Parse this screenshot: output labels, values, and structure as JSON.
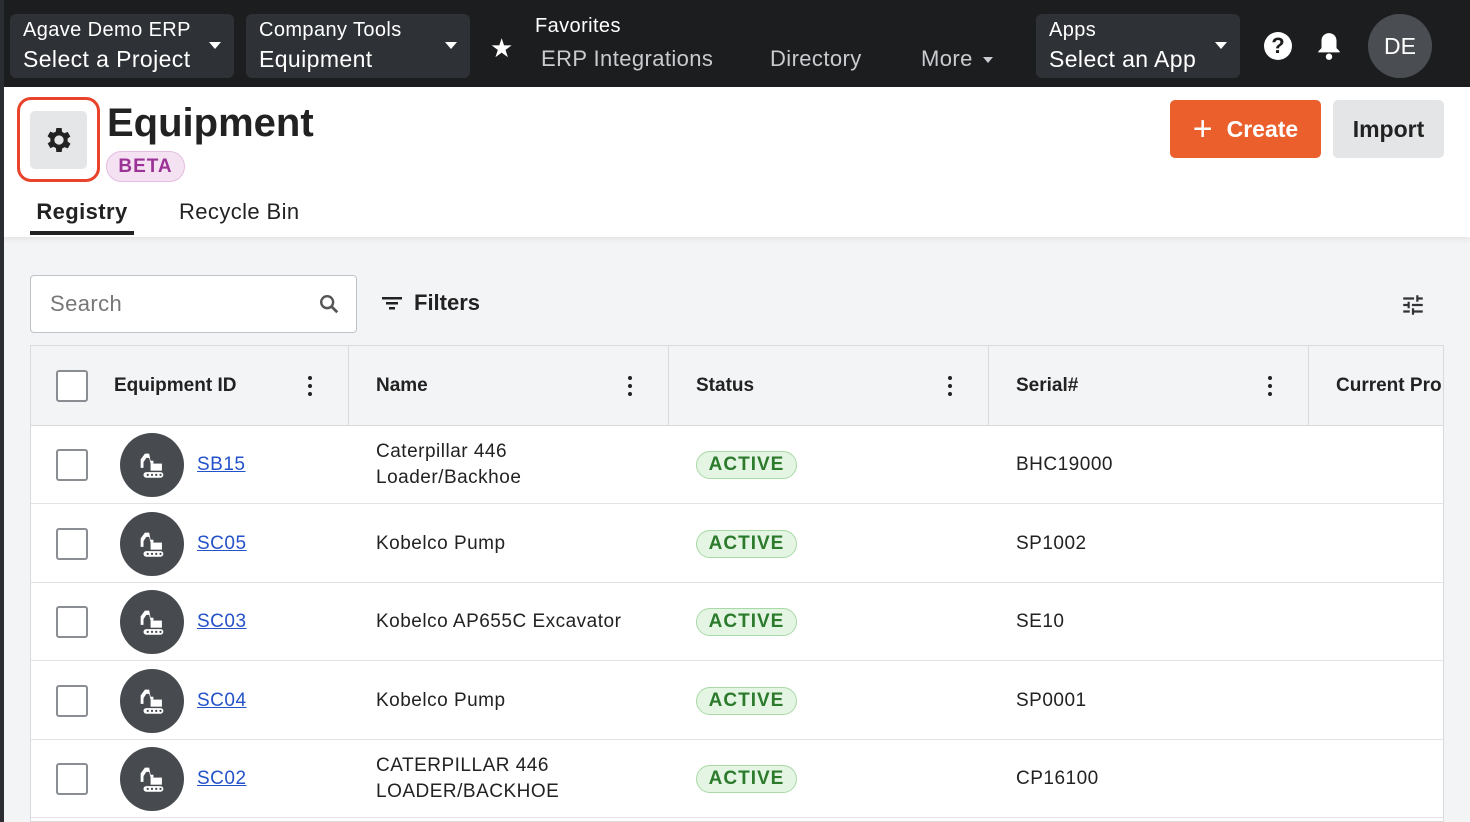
{
  "nav": {
    "project": {
      "label": "Agave Demo ERP",
      "value": "Select a Project"
    },
    "tools": {
      "label": "Company Tools",
      "value": "Equipment"
    },
    "favorites_label": "Favorites",
    "links": [
      "ERP Integrations",
      "Directory",
      "More"
    ],
    "apps": {
      "label": "Apps",
      "value": "Select an App"
    },
    "user_initials": "DE"
  },
  "header": {
    "title": "Equipment",
    "badge": "BETA",
    "create_label": "Create",
    "import_label": "Import",
    "tabs": [
      "Registry",
      "Recycle Bin"
    ],
    "active_tab": "Registry"
  },
  "toolbar": {
    "search_placeholder": "Search",
    "filters_label": "Filters"
  },
  "table": {
    "columns": [
      "Equipment ID",
      "Name",
      "Status",
      "Serial#",
      "Current Pro"
    ],
    "rows": [
      {
        "id": "SB15",
        "name": [
          "Caterpillar 446",
          "Loader/Backhoe"
        ],
        "status": "ACTIVE",
        "serial": "BHC19000"
      },
      {
        "id": "SC05",
        "name": [
          "Kobelco Pump"
        ],
        "status": "ACTIVE",
        "serial": "SP1002"
      },
      {
        "id": "SC03",
        "name": [
          "Kobelco AP655C Excavator"
        ],
        "status": "ACTIVE",
        "serial": "SE10"
      },
      {
        "id": "SC04",
        "name": [
          "Kobelco Pump"
        ],
        "status": "ACTIVE",
        "serial": "SP0001"
      },
      {
        "id": "SC02",
        "name": [
          "CATERPILLAR 446",
          "LOADER/BACKHOE"
        ],
        "status": "ACTIVE",
        "serial": "CP16100"
      }
    ]
  },
  "colors": {
    "accent": "#eb5f2d",
    "nav_bg": "#1c1d1f",
    "highlight": "#e8432b",
    "link": "#2452c9",
    "active_status": "#2c7a2c"
  }
}
